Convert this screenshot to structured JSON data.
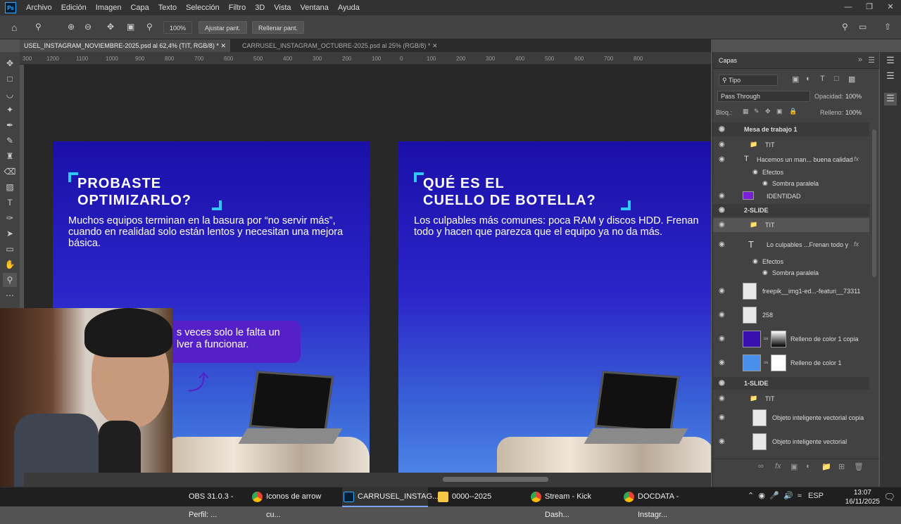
{
  "menu": {
    "items": [
      "Archivo",
      "Edición",
      "Imagen",
      "Capa",
      "Texto",
      "Selección",
      "Filtro",
      "3D",
      "Vista",
      "Ventana",
      "Ayuda"
    ],
    "app_icon": "Ps"
  },
  "options": {
    "zoom_value": "100%",
    "fit_button": "Ajustar pant.",
    "fill_button": "Rellenar pant."
  },
  "tabs": [
    {
      "label": "USEL_INSTAGRAM_NOVIEMBRE-2025.psd al 62,4% (TIT, RGB/8) *",
      "active": true
    },
    {
      "label": "CARRUSEL_INSTAGRAM_OCTUBRE-2025.psd al 25% (RGB/8) *",
      "active": false
    }
  ],
  "ruler_ticks": [
    "300",
    "1200",
    "1100",
    "1000",
    "900",
    "800",
    "700",
    "600",
    "500",
    "400",
    "300",
    "200",
    "100",
    "0",
    "100",
    "200",
    "300",
    "400",
    "500",
    "600",
    "700",
    "800"
  ],
  "slides": [
    {
      "title_line1": "PROBASTE",
      "title_line2": "OPTIMIZARLO?",
      "body": "Muchos equipos terminan en la basura por “no servir más”, cuando en realidad solo están lentos y necesitan una mejora básica.",
      "bubble_line1": "s veces solo le falta un",
      "bubble_line2": "lver a funcionar."
    },
    {
      "title_line1": "QUÉ ES EL",
      "title_line2": "CUELLO DE BOTELLA?",
      "body": "Los culpables más comunes: poca RAM y discos HDD. Frenan todo y hacen que parezca que el equipo ya no da más."
    }
  ],
  "layers_panel": {
    "title": "Capas",
    "filter": "Tipo",
    "blend_mode": "Pass Through",
    "opacity_label": "Opacidad:",
    "opacity_value": "100%",
    "lock_label": "Bloq.:",
    "fill_label": "Relleno:",
    "fill_value": "100%",
    "layers": [
      {
        "name": "Mesa de trabajo 1",
        "kind": "artboard"
      },
      {
        "name": "TIT",
        "kind": "folder"
      },
      {
        "name": "Hacemos un man... buena calidad",
        "kind": "text"
      },
      {
        "name": "Efectos",
        "kind": "effects"
      },
      {
        "name": "Sombra paralela",
        "kind": "effect"
      },
      {
        "name": "IDENTIDAD",
        "kind": "smart"
      },
      {
        "name": "2-SLIDE",
        "kind": "group"
      },
      {
        "name": "TIT",
        "kind": "folder"
      },
      {
        "name": "Lo culpables ...Frenan todo y",
        "kind": "text"
      },
      {
        "name": "Efectos",
        "kind": "effects"
      },
      {
        "name": "Sombra paralela",
        "kind": "effect"
      },
      {
        "name": "freepik__img1-ed...-featuri__73311",
        "kind": "smart"
      },
      {
        "name": "258",
        "kind": "smart"
      },
      {
        "name": "Relleno de color 1 copia",
        "kind": "fill"
      },
      {
        "name": "Relleno de color 1",
        "kind": "fill"
      },
      {
        "name": "1-SLIDE",
        "kind": "group"
      },
      {
        "name": "TIT",
        "kind": "folder"
      },
      {
        "name": "Objeto inteligente vectorial copia",
        "kind": "smart"
      },
      {
        "name": "Objeto inteligente vectorial",
        "kind": "smart"
      }
    ]
  },
  "taskbar": {
    "items": [
      "OBS 31.0.3 - Perfil: ...",
      "Iconos de arrow cu...",
      "CARRUSEL_INSTAG...",
      "0000--2025",
      "Stream - Kick Dash...",
      "DOCDATA - Instagr..."
    ],
    "active_index": 2,
    "lang": "ESP",
    "time": "13:07",
    "date": "16/11/2025"
  },
  "colors": {
    "accent_cyan": "#2ec8ff",
    "slide_top": "#1a0fa8",
    "slide_bottom": "#4f86e8"
  }
}
